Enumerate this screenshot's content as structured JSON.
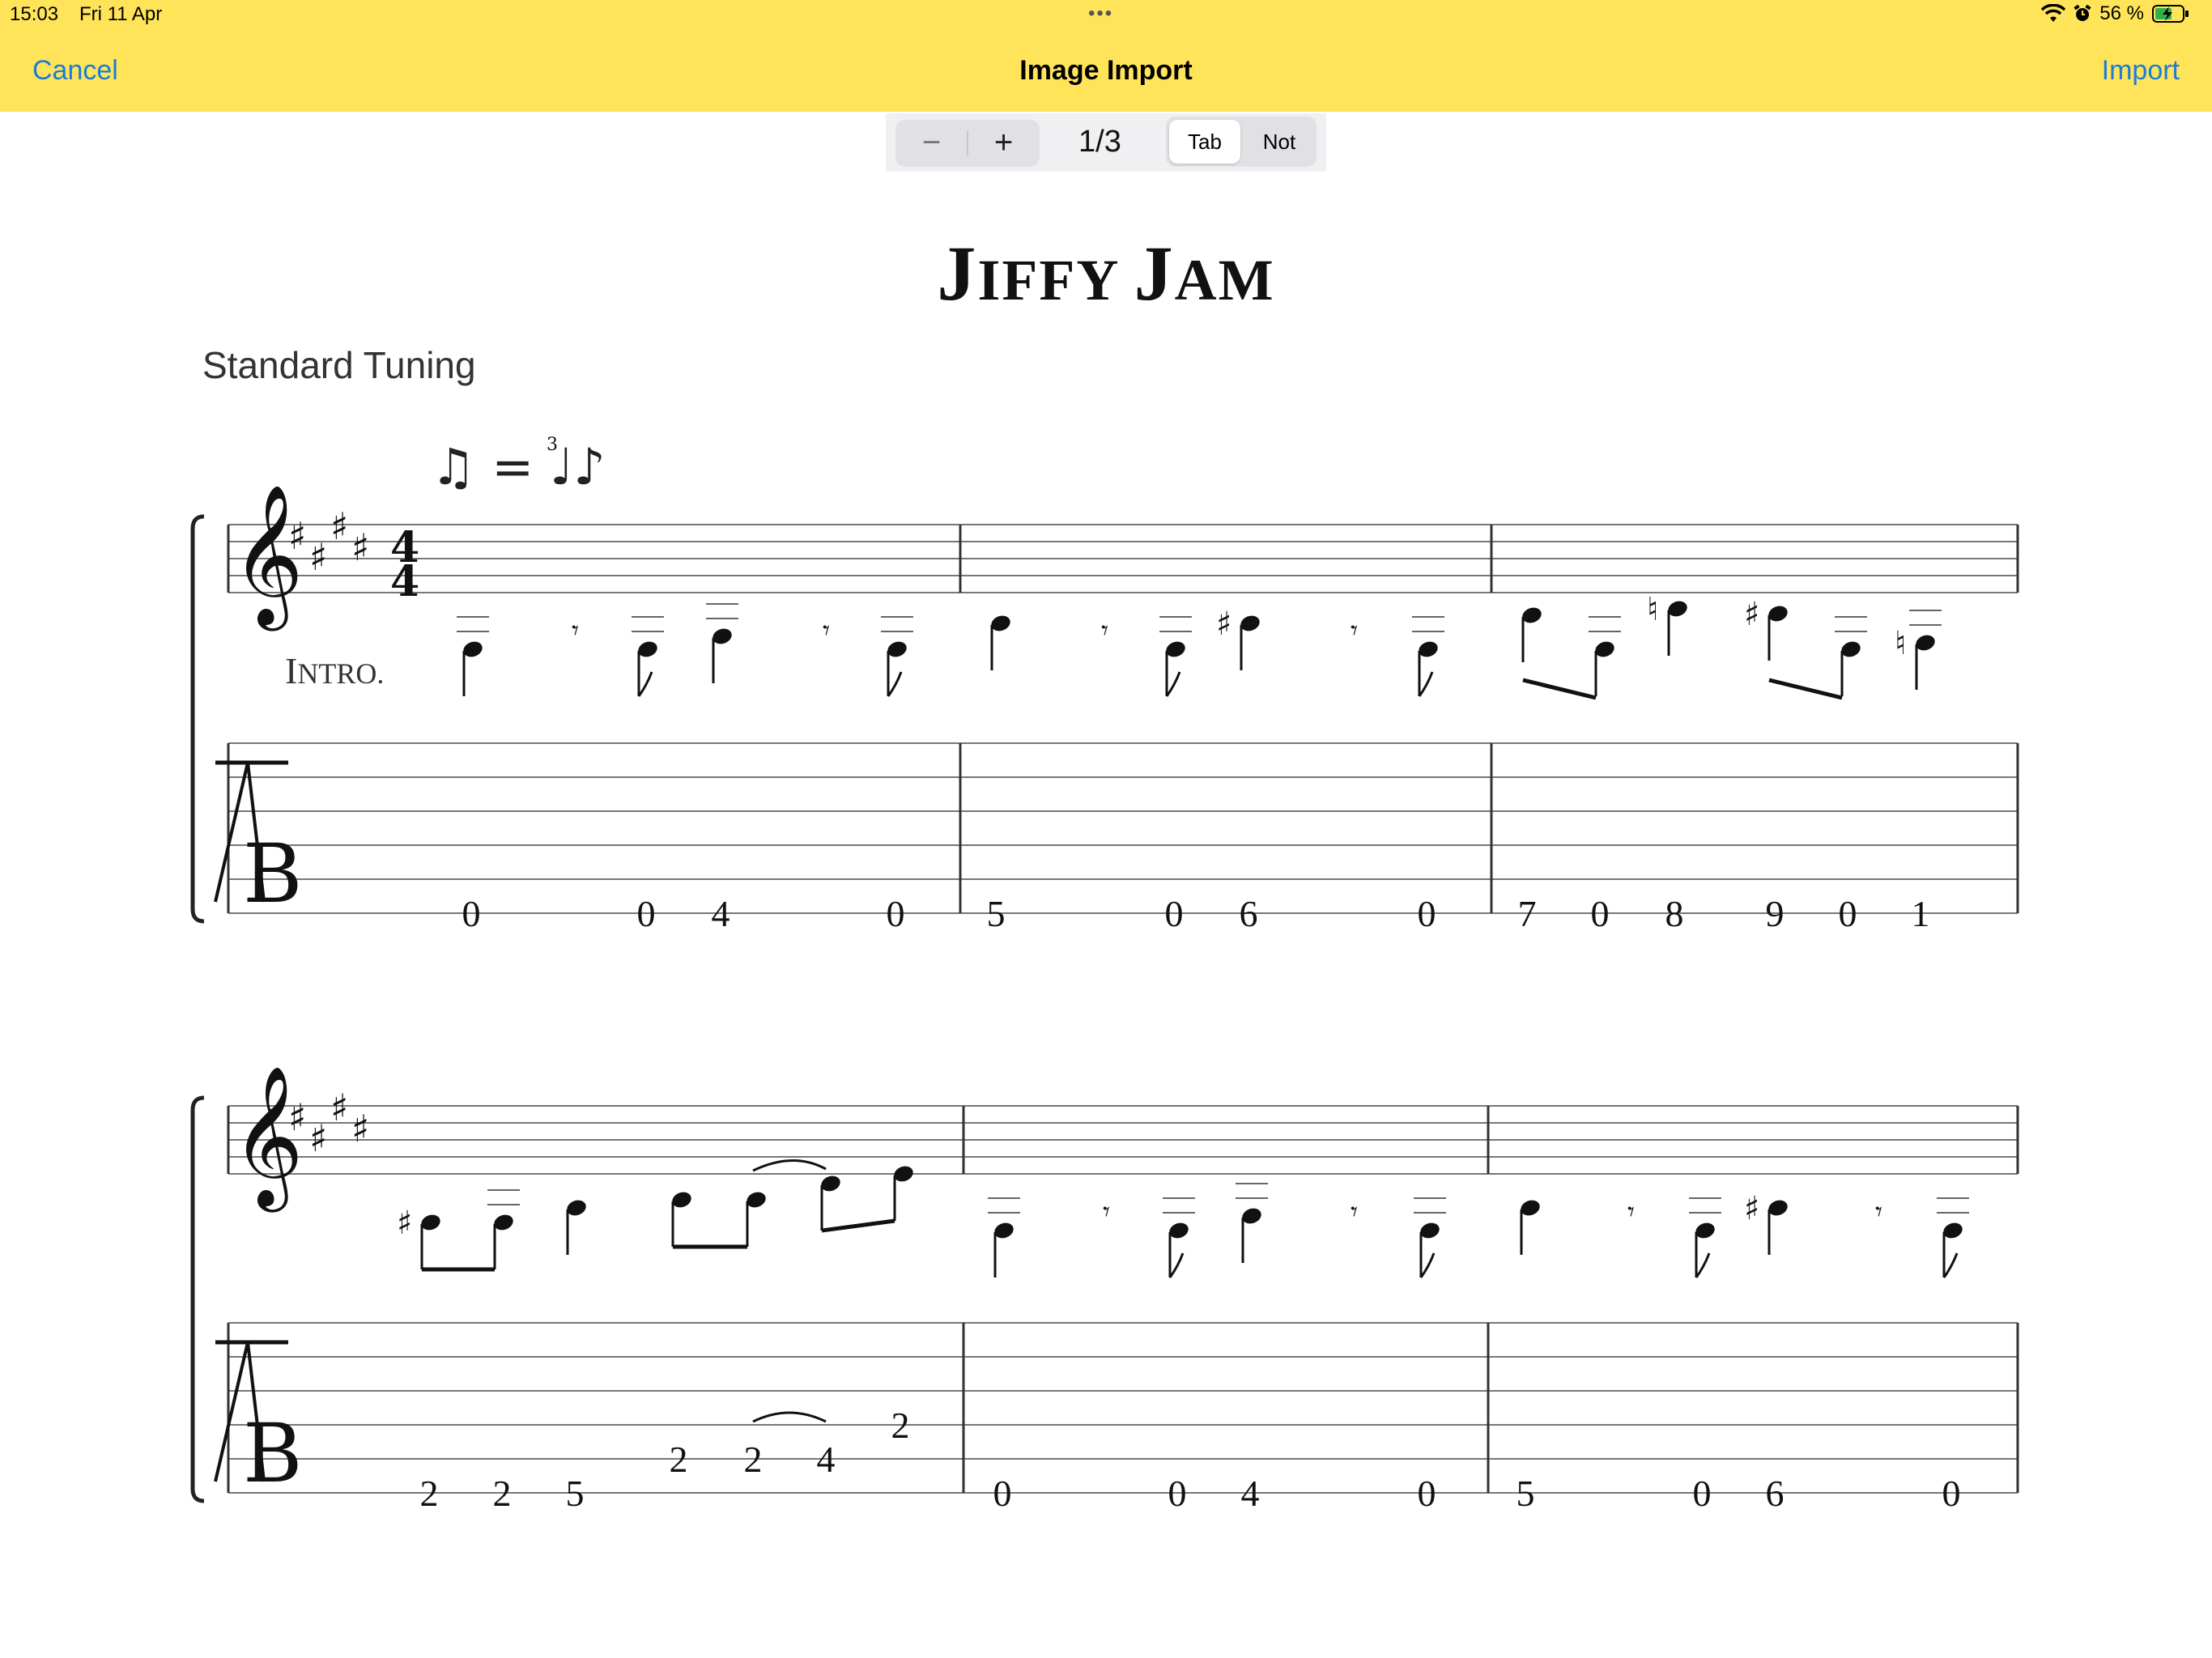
{
  "status": {
    "time": "15:03",
    "date": "Fri 11 Apr",
    "battery": "56 %",
    "multitask": "•••"
  },
  "nav": {
    "cancel": "Cancel",
    "title": "Image Import",
    "import": "Import"
  },
  "toolbar": {
    "minus": "−",
    "plus": "+",
    "page": "1/3",
    "segments": [
      "Tab",
      "Not"
    ],
    "selected_segment": "Tab"
  },
  "document": {
    "title_parts": [
      "J",
      "IFFY ",
      "J",
      "AM"
    ],
    "tuning": "Standard Tuning",
    "intro_parts": [
      "I",
      "NTRO."
    ],
    "tempo": "♫ = ♩♪",
    "triplet": "3"
  },
  "tab": {
    "system1": [
      [
        "0",
        "0",
        "4",
        "0"
      ],
      [
        "5",
        "0",
        "6",
        "0"
      ],
      [
        "7",
        "0",
        "8",
        "9",
        "0",
        "1"
      ]
    ],
    "system2": [
      [
        "2",
        "2",
        "5",
        "2",
        "2",
        "4",
        "2"
      ],
      [
        "0",
        "0",
        "4",
        "0"
      ],
      [
        "5",
        "0",
        "6",
        "0"
      ]
    ]
  },
  "colors": {
    "bar": "#ffe45a",
    "link": "#1a7cd9"
  },
  "icons": [
    "wifi-icon",
    "alarm-icon",
    "battery-icon",
    "minus-icon",
    "plus-icon",
    "treble-clef-icon",
    "sharp-icon",
    "tab-clef-icon"
  ]
}
